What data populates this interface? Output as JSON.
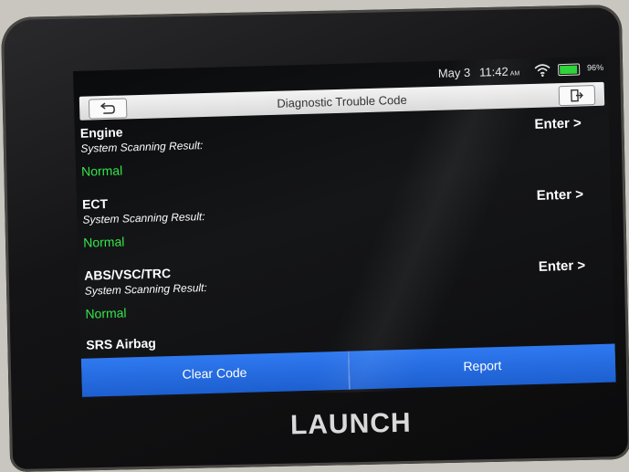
{
  "status": {
    "date": "May 3",
    "time": "11:42",
    "ampm": "AM",
    "battery": "96%",
    "battery_level": 0.96
  },
  "header": {
    "title": "Diagnostic Trouble Code"
  },
  "rows": [
    {
      "name": "Engine",
      "label": "System Scanning Result:",
      "status": "Normal",
      "action": "Enter >"
    },
    {
      "name": "ECT",
      "label": "System Scanning Result:",
      "status": "Normal",
      "action": "Enter >"
    },
    {
      "name": "ABS/VSC/TRC",
      "label": "System Scanning Result:",
      "status": "Normal",
      "action": "Enter >"
    }
  ],
  "partial_row": {
    "name": "SRS Airbag"
  },
  "footer": {
    "clear_label": "Clear Code",
    "report_label": "Report"
  },
  "device": {
    "brand": "LAUNCH"
  },
  "colors": {
    "status_normal": "#33e64a",
    "button_blue": "#2a6fe8",
    "battery_green": "#2fd33a"
  },
  "icons": [
    "back-arrow-icon",
    "exit-icon",
    "wifi-icon",
    "battery-icon"
  ]
}
